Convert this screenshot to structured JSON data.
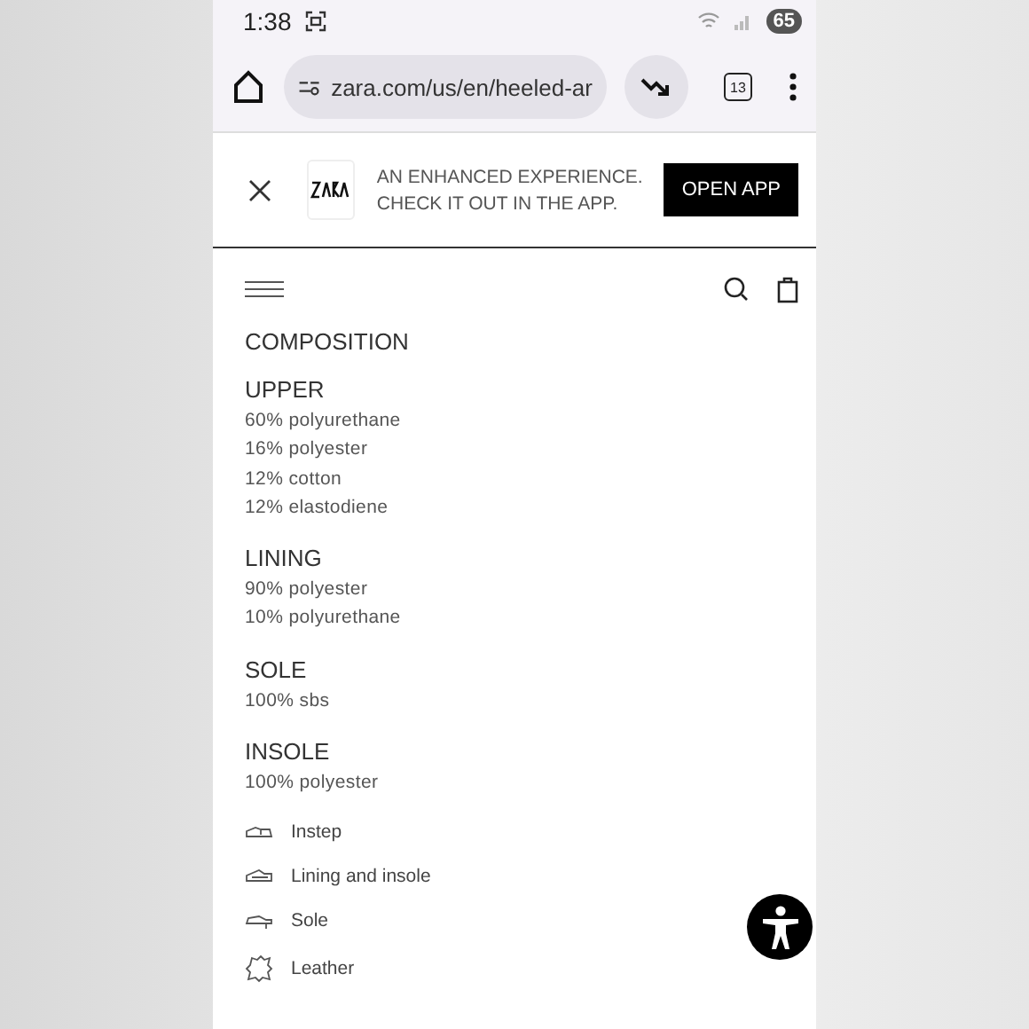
{
  "status_bar": {
    "time": "1:38",
    "battery": "65"
  },
  "browser": {
    "url": "zara.com/us/en/heeled-ar",
    "tab_count": "13"
  },
  "app_banner": {
    "line_1": "AN ENHANCED EXPERIENCE.",
    "line_2": "CHECK IT OUT IN THE APP.",
    "button": "OPEN APP"
  },
  "section_title": "COMPOSITION",
  "composition": [
    {
      "part": "UPPER",
      "materials": [
        "60% polyurethane",
        "16% polyester",
        "12% cotton",
        "12% elastodiene"
      ]
    },
    {
      "part": "LINING",
      "materials": [
        "90% polyester",
        "10% polyurethane"
      ]
    },
    {
      "part": "SOLE",
      "materials": [
        "100% sbs"
      ]
    },
    {
      "part": "INSOLE",
      "materials": [
        "100% polyester"
      ]
    }
  ],
  "care_items": [
    {
      "kind": "instep",
      "label": "Instep"
    },
    {
      "kind": "lining",
      "label": "Lining and insole"
    },
    {
      "kind": "sole",
      "label": "Sole"
    },
    {
      "kind": "leather",
      "label": "Leather"
    }
  ]
}
